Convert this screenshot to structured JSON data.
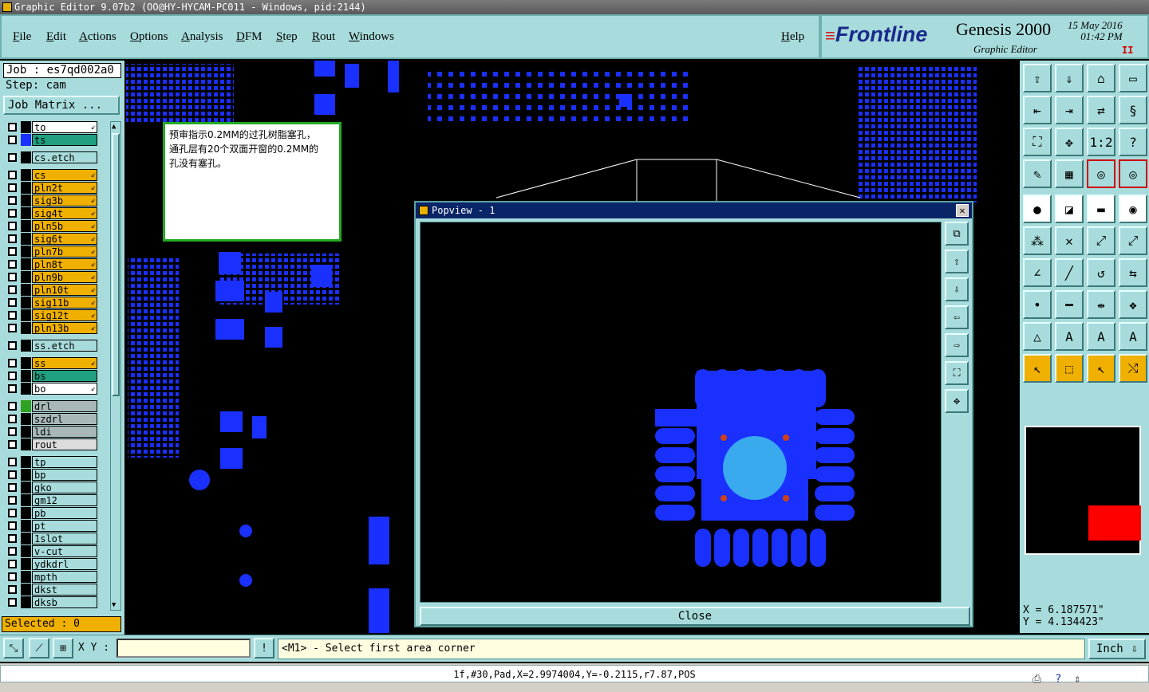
{
  "window": {
    "title": "Graphic Editor 9.07b2 (OO@HY-HYCAM-PC011 - Windows, pid:2144)"
  },
  "menu": [
    "File",
    "Edit",
    "Actions",
    "Options",
    "Analysis",
    "DFM",
    "Step",
    "Rout",
    "Windows"
  ],
  "help_label": "Help",
  "brand": {
    "logo": "Frontline",
    "product": "Genesis 2000",
    "subtitle": "Graphic Editor",
    "date": "15 May 2016",
    "time": "01:42 PM",
    "pause": "II"
  },
  "job": {
    "job_label": "Job : es7qd002a0",
    "step_label": "Step: cam",
    "matrix_button": "Job Matrix ..."
  },
  "layers": [
    {
      "name": "to",
      "bg": "#ffffff",
      "color": "#000000",
      "flag": "⇙"
    },
    {
      "name": "ts",
      "bg": "#20a080",
      "color": "#1a30ff",
      "flag": ""
    },
    {
      "name": "cs.etch",
      "bg": "#a8dcdc",
      "color": "#000000",
      "flag": ""
    },
    {
      "name": "cs",
      "bg": "#f0b000",
      "color": "#000000",
      "flag": "⇙"
    },
    {
      "name": "pln2t",
      "bg": "#f0b000",
      "color": "#000000",
      "flag": "⇙"
    },
    {
      "name": "sig3b",
      "bg": "#f0b000",
      "color": "#000000",
      "flag": "⇙"
    },
    {
      "name": "sig4t",
      "bg": "#f0b000",
      "color": "#000000",
      "flag": "⇙"
    },
    {
      "name": "pln5b",
      "bg": "#f0b000",
      "color": "#000000",
      "flag": "⇙"
    },
    {
      "name": "sig6t",
      "bg": "#f0b000",
      "color": "#000000",
      "flag": "⇙"
    },
    {
      "name": "pln7b",
      "bg": "#f0b000",
      "color": "#000000",
      "flag": "⇙"
    },
    {
      "name": "pln8t",
      "bg": "#f0b000",
      "color": "#000000",
      "flag": "⇙"
    },
    {
      "name": "pln9b",
      "bg": "#f0b000",
      "color": "#000000",
      "flag": "⇙"
    },
    {
      "name": "pln10t",
      "bg": "#f0b000",
      "color": "#000000",
      "flag": "⇙"
    },
    {
      "name": "sig11b",
      "bg": "#f0b000",
      "color": "#000000",
      "flag": "⇙"
    },
    {
      "name": "sig12t",
      "bg": "#f0b000",
      "color": "#000000",
      "flag": "⇙"
    },
    {
      "name": "pln13b",
      "bg": "#f0b000",
      "color": "#000000",
      "flag": "⇙"
    },
    {
      "name": "ss.etch",
      "bg": "#a8dcdc",
      "color": "#000000",
      "flag": ""
    },
    {
      "name": "ss",
      "bg": "#f0b000",
      "color": "#000000",
      "flag": "⇙"
    },
    {
      "name": "bs",
      "bg": "#20a080",
      "color": "#000000",
      "flag": ""
    },
    {
      "name": "bo",
      "bg": "#ffffff",
      "color": "#000000",
      "flag": "⇙"
    },
    {
      "name": "drl",
      "bg": "#a8b8b8",
      "color": "#30a020",
      "flag": ""
    },
    {
      "name": "szdrl",
      "bg": "#a8b8b8",
      "color": "#000000",
      "flag": ""
    },
    {
      "name": "ldi",
      "bg": "#a8b8b8",
      "color": "#000000",
      "flag": ""
    },
    {
      "name": "rout",
      "bg": "#dcdcdc",
      "color": "#000000",
      "flag": ""
    },
    {
      "name": "tp",
      "bg": "#a8dcdc",
      "color": "#000000",
      "flag": ""
    },
    {
      "name": "bp",
      "bg": "#a8dcdc",
      "color": "#000000",
      "flag": ""
    },
    {
      "name": "gko",
      "bg": "#a8dcdc",
      "color": "#000000",
      "flag": ""
    },
    {
      "name": "gm12",
      "bg": "#a8dcdc",
      "color": "#000000",
      "flag": ""
    },
    {
      "name": "pb",
      "bg": "#a8dcdc",
      "color": "#000000",
      "flag": ""
    },
    {
      "name": "pt",
      "bg": "#a8dcdc",
      "color": "#000000",
      "flag": ""
    },
    {
      "name": "1slot",
      "bg": "#a8dcdc",
      "color": "#000000",
      "flag": ""
    },
    {
      "name": "v-cut",
      "bg": "#a8dcdc",
      "color": "#000000",
      "flag": ""
    },
    {
      "name": "ydkdrl",
      "bg": "#a8dcdc",
      "color": "#000000",
      "flag": ""
    },
    {
      "name": "mpth",
      "bg": "#a8dcdc",
      "color": "#000000",
      "flag": ""
    },
    {
      "name": "dkst",
      "bg": "#a8dcdc",
      "color": "#000000",
      "flag": ""
    },
    {
      "name": "dksb",
      "bg": "#a8dcdc",
      "color": "#000000",
      "flag": ""
    }
  ],
  "selected_label": "Selected : 0",
  "note": {
    "lines": [
      "预审指示0.2MM的过孔树脂塞孔，",
      "通孔层有20个双面开窗的0.2MM的",
      "孔没有塞孔。"
    ]
  },
  "popview": {
    "title": "Popview - 1",
    "close_label": "Close"
  },
  "coords": {
    "x": "X =  6.187571\"",
    "y": "Y =  4.134423\""
  },
  "bottom": {
    "xy_label": "X Y :",
    "prompt": "<M1> - Select first area corner",
    "units": "Inch"
  },
  "status": {
    "text": "1f,#30,Pad,X=2.9974004,Y=-0.2115,r7.87,POS"
  },
  "icons": {
    "tool_palette": [
      "open-step-icon",
      "save-icon",
      "home-icon",
      "window-icon",
      "zoom-prev-icon",
      "zoom-next-icon",
      "swap-icon",
      "redraw-icon",
      "fit-icon",
      "center-icon",
      "one-to-one-icon",
      "query-icon",
      "measure-icon",
      "grid-icon",
      "snap-icon",
      "snap-alt-icon",
      "add-pad-icon",
      "add-line-icon",
      "ruler-icon",
      "circle-icon",
      "net-icon",
      "cross-icon",
      "move-icon",
      "copy-icon",
      "angle-icon",
      "line-icon",
      "arc-icon",
      "flip-icon",
      "feature-icon",
      "minus-icon",
      "resize-icon",
      "shapes-icon",
      "triangle-a-icon",
      "triangle-b-icon",
      "triangle-c-icon",
      "triangle-d-icon",
      "pointer-icon",
      "select-box-icon",
      "select-cursor-icon",
      "route-icon"
    ]
  }
}
